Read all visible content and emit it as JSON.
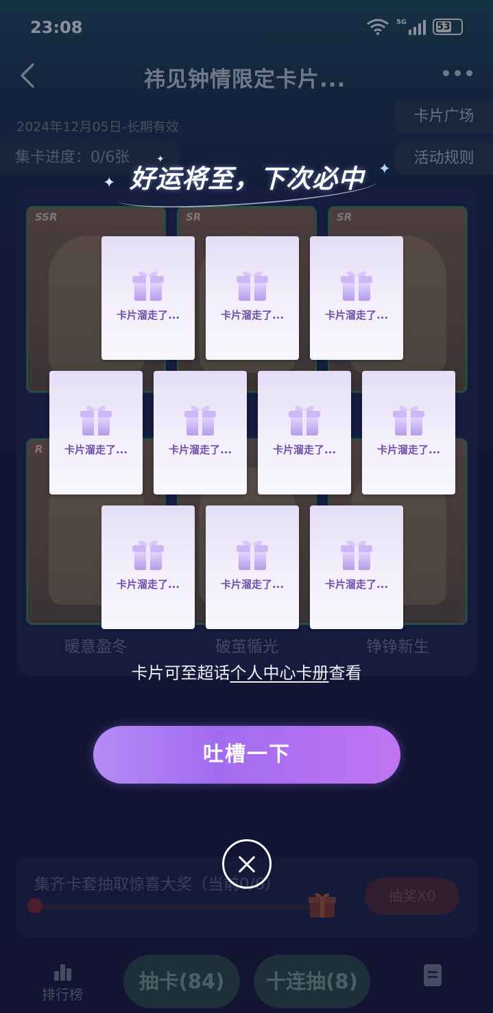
{
  "status_bar": {
    "time": "23:08",
    "network": "5G",
    "battery": "53"
  },
  "header": {
    "title": "祎见钟情限定卡片..."
  },
  "validity": "2024年12月05日-长期有效",
  "side_buttons": {
    "square": "卡片广场",
    "rules": "活动规则"
  },
  "progress": "集卡进度：0/6张",
  "background_cards": [
    {
      "rarity": "SSR"
    },
    {
      "rarity": "SR"
    },
    {
      "rarity": "SR"
    },
    {
      "rarity": "R"
    },
    {
      "rarity": ""
    },
    {
      "rarity": ""
    }
  ],
  "card_names": [
    "暖意盈冬",
    "破茧循光",
    "铮铮新生"
  ],
  "result": {
    "headline": "好运将至，下次必中",
    "card_label": "卡片溜走了...",
    "hint_prefix": "卡片可至超话",
    "hint_link": "个人中心卡册",
    "hint_suffix": "查看",
    "complain_button": "吐槽一下"
  },
  "lottery": {
    "text": "集齐卡套抽取惊喜大奖（当前0/6）",
    "button": "抽奖X0",
    "progress_fraction": 0
  },
  "bottom_nav": {
    "rank": "排行榜",
    "draw": "抽卡(84)",
    "draw_ten": "十连抽(8)"
  },
  "colors": {
    "accent_purple": "#a26cf0",
    "prize_label": "#6f4ea8",
    "overlay_bg": "#1b1d44"
  }
}
